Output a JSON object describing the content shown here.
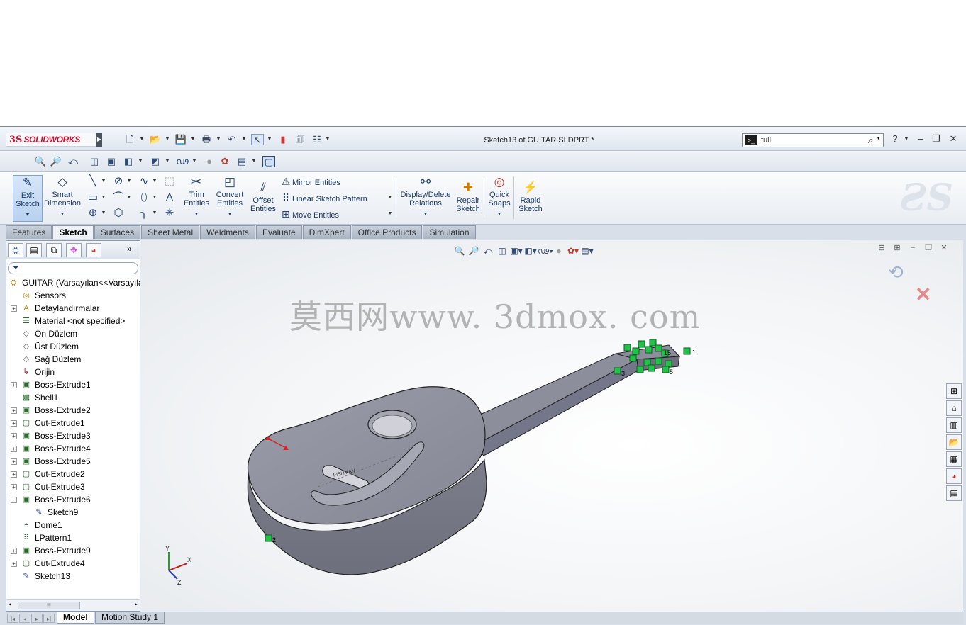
{
  "app": {
    "logo_ds": "3S",
    "logo_name": "SOLIDWORKS",
    "window_title": "Sketch13 of GUITAR.SLDPRT *",
    "search_value": "full"
  },
  "quickaccess_icons": [
    "new-document-icon",
    "open-folder-icon",
    "save-icon",
    "print-icon",
    "undo-icon",
    "select-arrow-icon",
    "rebuild-traffic-light-icon",
    "file-properties-icon",
    "options-icon"
  ],
  "view_toolbar_icons": [
    "zoom-to-fit-icon",
    "zoom-area-icon",
    "previous-view-icon",
    "section-view-icon",
    "view-orientation-icon",
    "display-style-icon",
    "hide-show-items-icon",
    "edit-appearance-icon",
    "apply-scene-icon",
    "view-settings-icon",
    "3d-box-icon"
  ],
  "command_manager": {
    "exit_sketch": "Exit\nSketch",
    "smart_dimension": "Smart\nDimension",
    "trim_entities": "Trim\nEntities",
    "convert_entities": "Convert\nEntities",
    "offset_entities": "Offset\nEntities",
    "mirror_entities": "Mirror Entities",
    "linear_sketch_pattern": "Linear Sketch Pattern",
    "move_entities": "Move Entities",
    "display_delete_relations": "Display/Delete\nRelations",
    "repair_sketch": "Repair\nSketch",
    "quick_snaps": "Quick\nSnaps",
    "rapid_sketch": "Rapid\nSketch"
  },
  "tabs": [
    {
      "label": "Features",
      "active": false
    },
    {
      "label": "Sketch",
      "active": true
    },
    {
      "label": "Surfaces",
      "active": false
    },
    {
      "label": "Sheet Metal",
      "active": false
    },
    {
      "label": "Weldments",
      "active": false
    },
    {
      "label": "Evaluate",
      "active": false
    },
    {
      "label": "DimXpert",
      "active": false
    },
    {
      "label": "Office Products",
      "active": false
    },
    {
      "label": "Simulation",
      "active": false
    }
  ],
  "tree": [
    {
      "label": "GUITAR  (Varsayılan<<Varsayıla",
      "icon": "part-icon",
      "level": 0,
      "expander": ""
    },
    {
      "label": "Sensors",
      "icon": "sensors-icon",
      "level": 1,
      "expander": ""
    },
    {
      "label": "Detaylandırmalar",
      "icon": "annotations-icon",
      "level": 1,
      "expander": "+"
    },
    {
      "label": "Material <not specified>",
      "icon": "material-icon",
      "level": 1,
      "expander": ""
    },
    {
      "label": "Ön Düzlem",
      "icon": "plane-icon",
      "level": 1,
      "expander": ""
    },
    {
      "label": "Üst Düzlem",
      "icon": "plane-icon",
      "level": 1,
      "expander": ""
    },
    {
      "label": "Sağ Düzlem",
      "icon": "plane-icon",
      "level": 1,
      "expander": ""
    },
    {
      "label": "Orijin",
      "icon": "origin-icon",
      "level": 1,
      "expander": ""
    },
    {
      "label": "Boss-Extrude1",
      "icon": "extrude-icon",
      "level": 1,
      "expander": "+"
    },
    {
      "label": "Shell1",
      "icon": "shell-icon",
      "level": 1,
      "expander": ""
    },
    {
      "label": "Boss-Extrude2",
      "icon": "extrude-icon",
      "level": 1,
      "expander": "+"
    },
    {
      "label": "Cut-Extrude1",
      "icon": "cut-extrude-icon",
      "level": 1,
      "expander": "+"
    },
    {
      "label": "Boss-Extrude3",
      "icon": "extrude-icon",
      "level": 1,
      "expander": "+"
    },
    {
      "label": "Boss-Extrude4",
      "icon": "extrude-icon",
      "level": 1,
      "expander": "+"
    },
    {
      "label": "Boss-Extrude5",
      "icon": "extrude-icon",
      "level": 1,
      "expander": "+"
    },
    {
      "label": "Cut-Extrude2",
      "icon": "cut-extrude-icon",
      "level": 1,
      "expander": "+"
    },
    {
      "label": "Cut-Extrude3",
      "icon": "cut-extrude-icon",
      "level": 1,
      "expander": "+"
    },
    {
      "label": "Boss-Extrude6",
      "icon": "extrude-icon",
      "level": 1,
      "expander": "-"
    },
    {
      "label": "Sketch9",
      "icon": "sketch-icon",
      "level": 2,
      "expander": ""
    },
    {
      "label": "Dome1",
      "icon": "dome-icon",
      "level": 1,
      "expander": ""
    },
    {
      "label": "LPattern1",
      "icon": "linear-pattern-icon",
      "level": 1,
      "expander": ""
    },
    {
      "label": "Boss-Extrude9",
      "icon": "extrude-icon",
      "level": 1,
      "expander": "+"
    },
    {
      "label": "Cut-Extrude4",
      "icon": "cut-extrude-icon",
      "level": 1,
      "expander": "+"
    },
    {
      "label": "Sketch13",
      "icon": "sketch-icon",
      "level": 1,
      "expander": ""
    }
  ],
  "viewport": {
    "watermark": "莫西网www. 3dmox. com",
    "triad_labels": {
      "x": "X",
      "y": "Y",
      "z": "Z"
    },
    "sketch_point_labels": {
      "p1": "1",
      "p2": "2",
      "p3": "3",
      "p5": "5",
      "p15": "15"
    },
    "bridge_text": "FISHMAN"
  },
  "bottom_tabs": [
    {
      "label": "Model",
      "active": true
    },
    {
      "label": "Motion Study 1",
      "active": false
    }
  ],
  "colors": {
    "brand_red": "#c8102e",
    "sketch_green": "#22c24a",
    "body_gray": "#8c8e9b"
  }
}
